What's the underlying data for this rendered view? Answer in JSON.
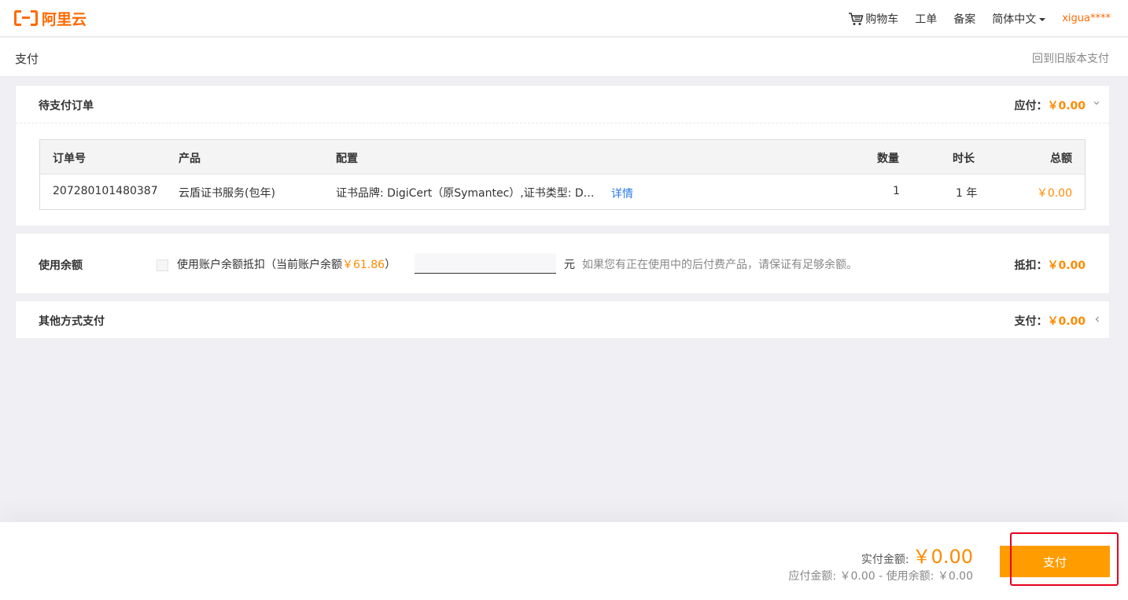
{
  "brand": {
    "logo_text": "阿里云",
    "accent_color": "#ff6a00",
    "amount_color": "#ff8a00",
    "button_color": "#ff9c00",
    "highlight_color": "#e8001c"
  },
  "nav": {
    "cart": "购物车",
    "tickets": "工单",
    "filing": "备案",
    "language": "简体中文",
    "user": "xigua****"
  },
  "page": {
    "title": "支付",
    "back_link": "回到旧版本支付"
  },
  "orders": {
    "title": "待支付订单",
    "amount_label": "应付：",
    "amount_value": "￥0.00",
    "toggle_icon": "chevron-down-icon",
    "columns": {
      "id": "订单号",
      "product": "产品",
      "config": "配置",
      "quantity": "数量",
      "duration": "时长",
      "total": "总额"
    },
    "rows": [
      {
        "id": "207280101480387",
        "product": "云盾证书服务(包年)",
        "config": "证书品牌: DigiCert（原Symantec）,证书类型: DV SSL,域名类型: 单域名...",
        "detail": "详情",
        "quantity": "1",
        "duration": "1 年",
        "total": "￥0.00"
      }
    ]
  },
  "balance": {
    "title": "使用余额",
    "checkbox_label": "使用账户余额抵扣（当前账户余额",
    "balance_value": "￥61.86",
    "checkbox_label_end": "）",
    "input_value": "",
    "unit": "元",
    "hint": "如果您有正在使用中的后付费产品，请保证有足够余额。",
    "amount_label": "抵扣：",
    "amount_value": "￥0.00"
  },
  "other": {
    "title": "其他方式支付",
    "amount_label": "支付：",
    "amount_value": "￥0.00",
    "toggle_icon": "chevron-left-icon"
  },
  "footer": {
    "actual_label": "实付金额:",
    "actual_value": "￥0.00",
    "breakdown": "应付金额: ￥0.00 - 使用余额: ￥0.00",
    "pay_button": "支付"
  }
}
